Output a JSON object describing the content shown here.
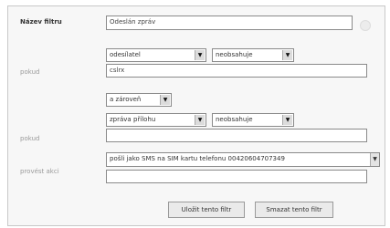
{
  "filter": {
    "name_label": "Název filtru",
    "name_value": "Odeslán zpráv",
    "rule1": {
      "label": "pokud",
      "field": "odesílatel",
      "operator": "neobsahuje",
      "value": "cslrx"
    },
    "connector": "a zároveň",
    "rule2": {
      "label": "pokud",
      "field": "zpráva přílohu",
      "operator": "neobsahuje",
      "value": ""
    },
    "action": {
      "label": "provést akci",
      "value": "pošli jako SMS na SIM kartu telefonu 00420604707349"
    }
  },
  "buttons": {
    "save": "Uložit tento filtr",
    "delete": "Smazat tento filtr"
  },
  "icons": {
    "select_arrow": "▼"
  }
}
